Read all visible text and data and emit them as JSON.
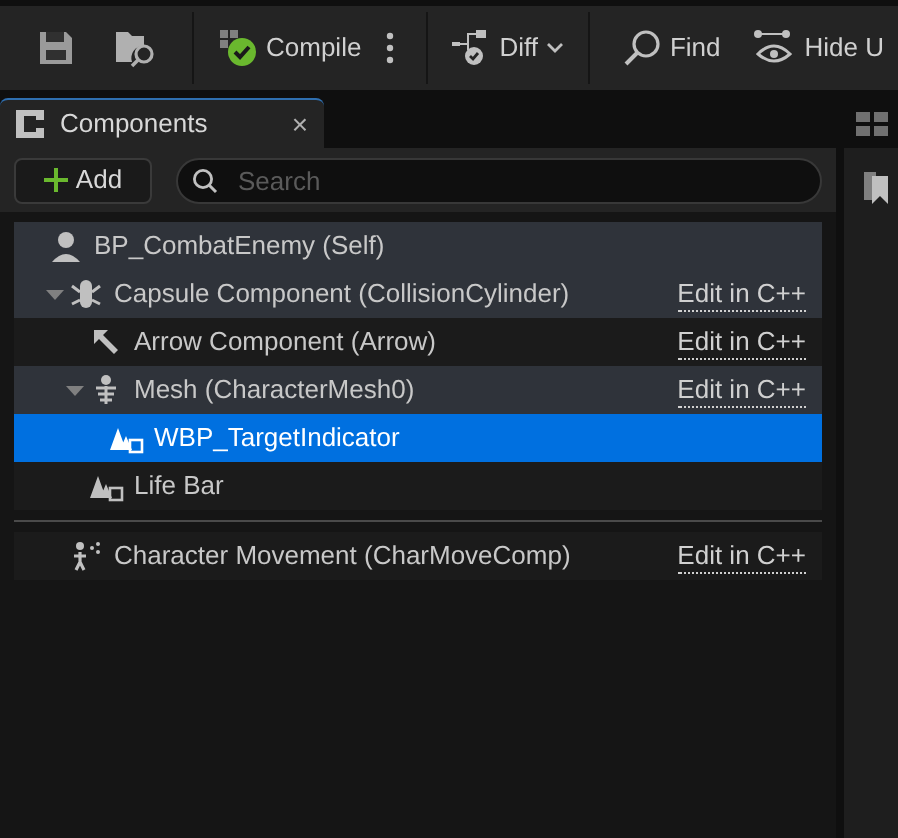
{
  "toolbar": {
    "buttons": [
      {
        "kind": "save"
      },
      {
        "kind": "browse"
      },
      {
        "kind": "compile",
        "label": "Compile"
      },
      {
        "kind": "more"
      },
      {
        "kind": "diff",
        "label": "Diff"
      },
      {
        "kind": "find",
        "label": "Find"
      },
      {
        "kind": "hide",
        "label": "Hide U"
      }
    ]
  },
  "panel_tab": {
    "title": "Components",
    "close": "×"
  },
  "add_button": {
    "label": "Add"
  },
  "search": {
    "placeholder": "Search"
  },
  "tree": [
    {
      "label": "BP_CombatEnemy (Self)",
      "kind": "self",
      "selected": false,
      "children": [
        {
          "label": "Capsule Component (CollisionCylinder)",
          "kind": "capsule",
          "expanded": true,
          "selected": false,
          "link": "Edit in C++",
          "children": [
            {
              "label": "Arrow Component (Arrow)",
              "kind": "arrow",
              "selected": false,
              "link": "Edit in C++"
            },
            {
              "label": "Mesh (CharacterMesh0)",
              "kind": "mesh",
              "expanded": true,
              "selected": false,
              "link": "Edit in C++",
              "children": [
                {
                  "label": "WBP_TargetIndicator",
                  "kind": "widget",
                  "selected": true
                }
              ]
            },
            {
              "label": "Life Bar",
              "kind": "widget",
              "selected": false
            }
          ]
        }
      ]
    }
  ],
  "other_components": [
    {
      "label": "Character Movement (CharMoveComp)",
      "kind": "movement",
      "selected": false,
      "link": "Edit in C++"
    }
  ]
}
